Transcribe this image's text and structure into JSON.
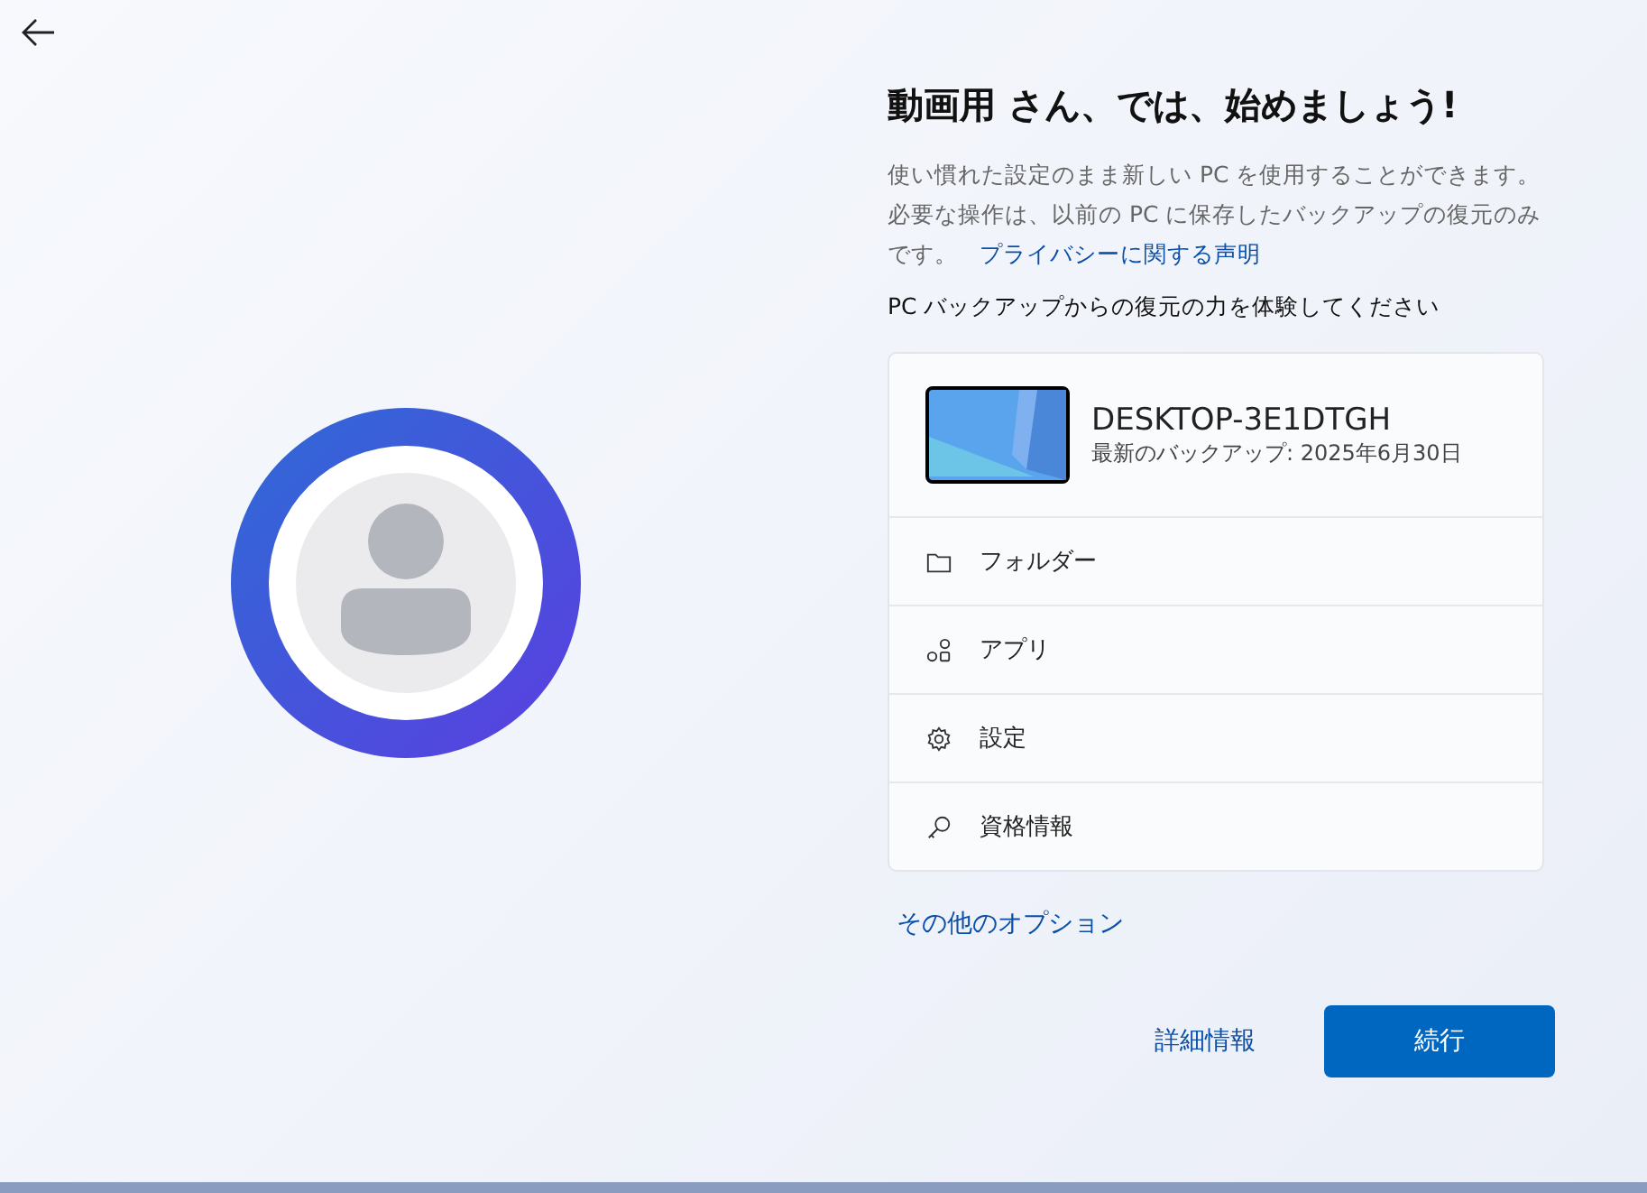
{
  "title": "動画用 さん、では、始めましょう!",
  "description": "使い慣れた設定のまま新しい PC を使用することができます。必要な操作は、以前の PC に保存したバックアップの復元のみです。",
  "privacy_link": "プライバシーに関する声明",
  "subheading": "PC バックアップからの復元の力を体験してください",
  "backup_card": {
    "device_name": "DESKTOP-3E1DTGH",
    "last_backup": "最新のバックアップ: 2025年6月30日",
    "items": [
      {
        "kind": "folder",
        "label": "フォルダー"
      },
      {
        "kind": "apps",
        "label": "アプリ"
      },
      {
        "kind": "settings",
        "label": "設定"
      },
      {
        "kind": "key",
        "label": "資格情報"
      }
    ]
  },
  "more_options_link": "その他のオプション",
  "buttons": [
    {
      "kind": "link",
      "label": "詳細情報"
    },
    {
      "kind": "primary",
      "label": "続行"
    }
  ]
}
